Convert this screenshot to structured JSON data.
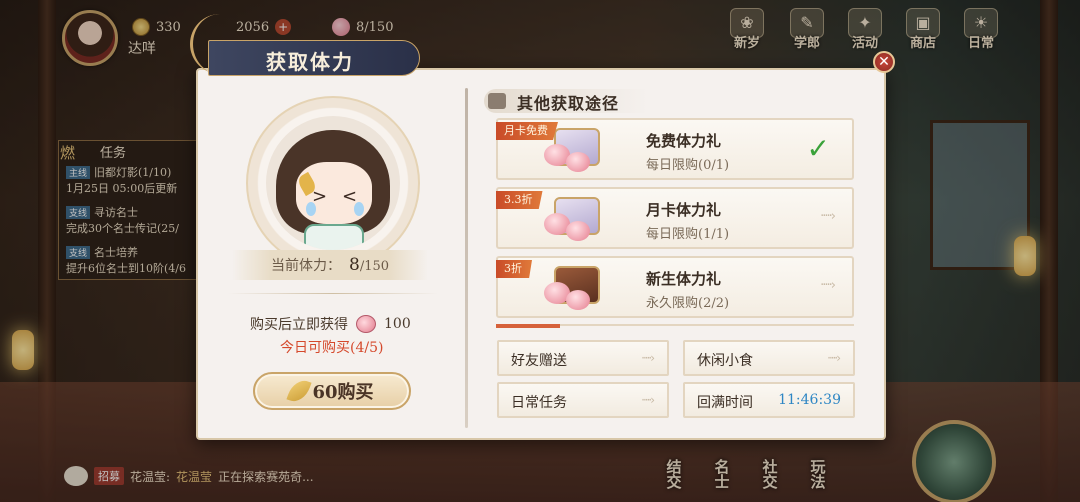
{
  "hud": {
    "player_name": "达咩",
    "coins": "330",
    "gold": "2056",
    "stamina_top": "8/150"
  },
  "top_menu": [
    {
      "label": "新岁",
      "icon": "new-year-icon"
    },
    {
      "label": "学郎",
      "icon": "scholar-icon"
    },
    {
      "label": "活动",
      "icon": "event-icon"
    },
    {
      "label": "商店",
      "icon": "shop-icon"
    },
    {
      "label": "日常",
      "icon": "daily-icon"
    }
  ],
  "quests": {
    "title": "任务",
    "badge": "燃",
    "items": [
      {
        "tag": "主线",
        "text": "旧都灯影(1/10)"
      },
      {
        "tag": "",
        "text": "1月25日 05:00后更新"
      },
      {
        "tag": "支线",
        "text": "寻访名士"
      },
      {
        "tag": "",
        "text": "完成30个名士传记(25/"
      },
      {
        "tag": "支线",
        "text": "名士培养"
      },
      {
        "tag": "",
        "text": "提升6位名士到10阶(4/6"
      }
    ]
  },
  "chat": {
    "tag": "招募",
    "speaker": "花温莹:",
    "highlight": "花温莹",
    "message": "正在探索赛苑奇..."
  },
  "bottom_nav": [
    "结交",
    "名士",
    "社交",
    "玩法"
  ],
  "dialog": {
    "title": "获取体力",
    "close_icon": "close-icon",
    "stamina_label": "当前体力：",
    "stamina_current": "8",
    "stamina_max": "/150",
    "buy_info_label": "购买后立即获得",
    "buy_info_amount": "100",
    "buy_limit": "今日可购买(4/5)",
    "buy_button": "60购买",
    "other_title": "其他获取途径",
    "offers": [
      {
        "tag": "月卡免费",
        "name": "免费体力礼",
        "limit": "每日限购(0/1)",
        "claimed": true
      },
      {
        "tag": "3.3折",
        "name": "月卡体力礼",
        "limit": "每日限购(1/1)",
        "claimed": false
      },
      {
        "tag": "3折",
        "name": "新生体力礼",
        "limit": "永久限购(2/2)",
        "claimed": false
      }
    ],
    "arrow_glyph": "·····›",
    "check_glyph": "✓",
    "actions": {
      "friend_gift": "好友赠送",
      "snack": "休闲小食",
      "daily_task": "日常任务",
      "refill_label": "回满时间",
      "refill_time": "11:46:39"
    }
  },
  "colors": {
    "accent_red": "#d5492c",
    "timer_blue": "#2e86c4",
    "check_green": "#3aa23a",
    "title_plate": "#2a3048"
  }
}
